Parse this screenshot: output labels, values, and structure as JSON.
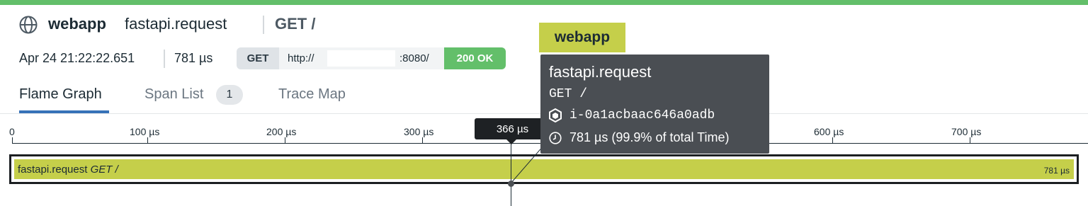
{
  "header": {
    "service": "webapp",
    "operation": "fastapi.request",
    "resource": "GET /",
    "timestamp": "Apr 24 21:22:22.651",
    "duration": "781 µs",
    "request": {
      "method": "GET",
      "url_prefix": "http://",
      "url_port": ":8080/",
      "status": "200 OK"
    },
    "icons": {
      "service": "globe-icon"
    },
    "colors": {
      "accent_top": "#63bf6a",
      "status_ok": "#63bf6a",
      "span_color": "#c5cf4a"
    }
  },
  "tabs": [
    {
      "label": "Flame Graph",
      "active": true
    },
    {
      "label": "Span List",
      "badge": "1",
      "active": false
    },
    {
      "label": "Trace Map",
      "active": false
    }
  ],
  "ruler": {
    "ticks": [
      "0",
      "100 µs",
      "200 µs",
      "300 µs",
      "600 µs",
      "700 µs"
    ],
    "cursor": "366 µs"
  },
  "span": {
    "operation": "fastapi.request",
    "resource": "GET /",
    "duration": "781 µs"
  },
  "tooltip": {
    "service": "webapp",
    "operation": "fastapi.request",
    "resource": "GET /",
    "host": "i-0a1acbaac646a0adb",
    "time": "781 µs (99.9% of total Time)",
    "icons": {
      "host": "hexagon-host-icon",
      "time": "clock-icon"
    }
  }
}
